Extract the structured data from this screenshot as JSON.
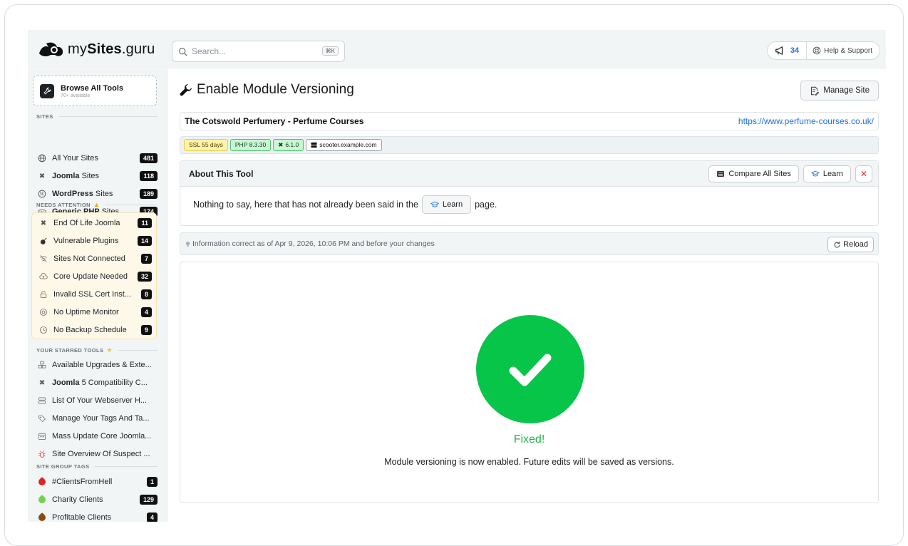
{
  "brand": {
    "name_prefix": "my",
    "name_bold": "Sites",
    "name_suffix": ".guru"
  },
  "search": {
    "placeholder": "Search...",
    "shortcut": "⌘K"
  },
  "header": {
    "notifications_count": "34",
    "help_label": "Help & Support"
  },
  "sidebar": {
    "browse": {
      "title": "Browse All Tools",
      "subtitle": "70+ available"
    },
    "sites_title": "SITES",
    "sites": [
      {
        "label": "All Your Sites",
        "bold": "",
        "rest": "",
        "count": "481",
        "icon": "globe-icon"
      },
      {
        "label": "",
        "bold": "Joomla",
        "rest": " Sites",
        "count": "118",
        "icon": "joomla-icon"
      },
      {
        "label": "",
        "bold": "WordPress",
        "rest": " Sites",
        "count": "189",
        "icon": "wordpress-icon"
      },
      {
        "label": "",
        "bold": "Generic PHP",
        "rest": " Sites",
        "count": "174",
        "icon": "php-icon"
      }
    ],
    "attention_title": "NEEDS ATTENTION",
    "attention": [
      {
        "label": "End Of Life Joomla",
        "count": "11",
        "icon": "joomla-icon"
      },
      {
        "label": "Vulnerable Plugins",
        "count": "14",
        "icon": "bomb-icon"
      },
      {
        "label": "Sites Not Connected",
        "count": "7",
        "icon": "wifi-off-icon"
      },
      {
        "label": "Core Update Needed",
        "count": "32",
        "icon": "cloud-up-icon"
      },
      {
        "label": "Invalid SSL Cert Inst...",
        "count": "8",
        "icon": "lock-icon"
      },
      {
        "label": "No Uptime Monitor",
        "count": "4",
        "icon": "target-icon"
      },
      {
        "label": "No Backup Schedule",
        "count": "9",
        "icon": "clock-icon"
      }
    ],
    "starred_title": "YOUR STARRED TOOLS",
    "starred": [
      {
        "label": "Available Upgrades & Exte...",
        "bold": "",
        "icon": "boxes-icon"
      },
      {
        "label": " 5 Compatibility C...",
        "bold": "Joomla",
        "icon": "joomla-icon"
      },
      {
        "label": "List Of Your Webserver H...",
        "bold": "",
        "icon": "server-icon"
      },
      {
        "label": "Manage Your Tags And Ta...",
        "bold": "",
        "icon": "tag-icon"
      },
      {
        "label": "Mass Update Core Joomla...",
        "bold": "",
        "icon": "calendar-icon"
      },
      {
        "label": "Site Overview Of Suspect ...",
        "bold": "",
        "icon": "bug-icon"
      }
    ],
    "group_tags_title": "SITE GROUP TAGS",
    "group_tags": [
      {
        "label": "#ClientsFromHell",
        "count": "1",
        "color": "#e02424"
      },
      {
        "label": "Charity Clients",
        "count": "129",
        "color": "#6cd64a"
      },
      {
        "label": "Profitable Clients",
        "count": "4",
        "color": "#8a4b12"
      }
    ]
  },
  "main": {
    "title": "Enable Module Versioning",
    "manage_label": "Manage Site",
    "site_name": "The Cotswold Perfumery - Perfume Courses",
    "site_url": "https://www.perfume-courses.co.uk/",
    "chips": {
      "ssl": "SSL 55 days",
      "php": "PHP 8.3.30",
      "version": "6.1.0",
      "host": "scooter.example.com"
    },
    "about": {
      "title": "About This Tool",
      "compare_label": "Compare All Sites",
      "learn_label": "Learn",
      "close_label": "✕",
      "body_before": "Nothing to say, here that has not already been said in the",
      "body_learn": "Learn",
      "body_after": "page."
    },
    "info": {
      "text": "Information correct as of Apr 9, 2026, 10:06 PM and before your changes",
      "reload_label": "Reload"
    },
    "result": {
      "status": "Fixed!",
      "message": "Module versioning is now enabled. Future edits will be saved as versions."
    }
  },
  "colors": {
    "accent_link": "#1d6fe0",
    "success": "#06c549",
    "success_text": "#1fb34a",
    "sidebar_bg": "#f1f5f6"
  }
}
